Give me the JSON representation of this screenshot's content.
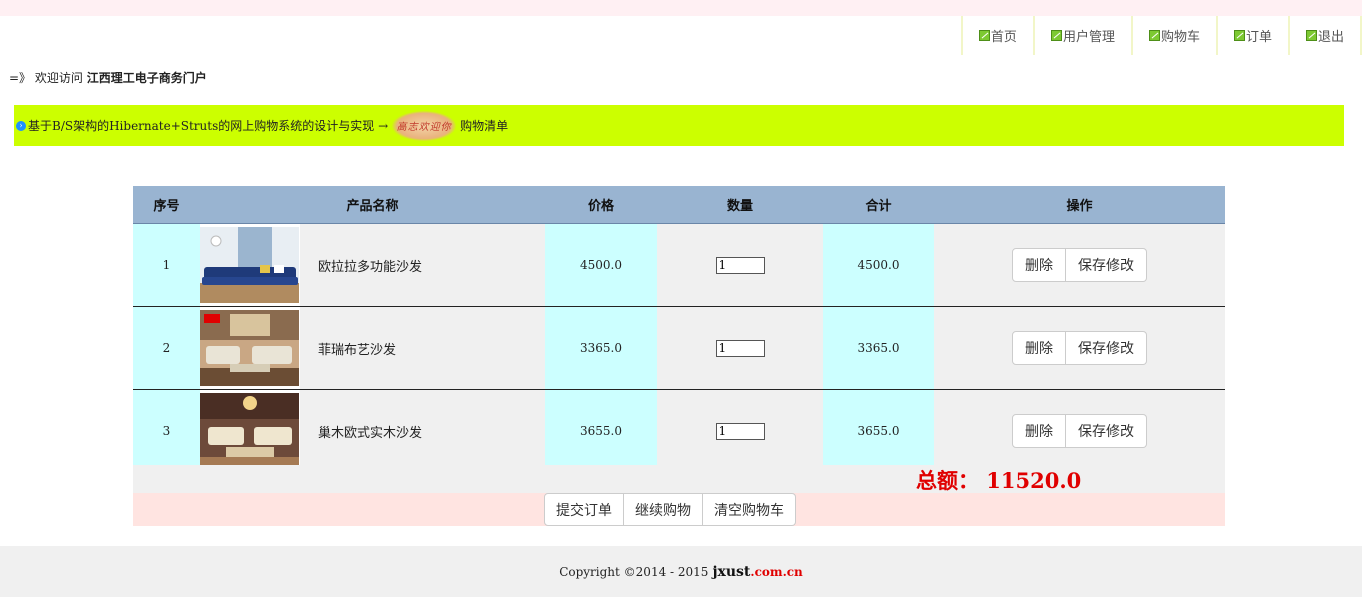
{
  "nav": {
    "items": [
      {
        "label": "首页"
      },
      {
        "label": "用户管理"
      },
      {
        "label": "购物车"
      },
      {
        "label": "订单"
      },
      {
        "label": "退出"
      }
    ]
  },
  "welcome": {
    "prefix": "=》 欢迎访问",
    "site_name": "江西理工电子商务门户"
  },
  "banner": {
    "breadcrumb": "基于B/S架构的Hibernate+Struts的网上购物系统的设计与实现 →",
    "welcome_image_text": "高志欢迎你",
    "page": "购物清单"
  },
  "table": {
    "headers": [
      "序号",
      "产品名称",
      "价格",
      "数量",
      "合计",
      "操作"
    ],
    "rows": [
      {
        "index": "1",
        "name": "欧拉拉多功能沙发",
        "price": "4500.0",
        "qty": "1",
        "subtotal": "4500.0"
      },
      {
        "index": "2",
        "name": "菲瑞布艺沙发",
        "price": "3365.0",
        "qty": "1",
        "subtotal": "3365.0"
      },
      {
        "index": "3",
        "name": "巢木欧式实木沙发",
        "price": "3655.0",
        "qty": "1",
        "subtotal": "3655.0"
      }
    ],
    "delete_label": "删除",
    "save_label": "保存修改"
  },
  "summary": {
    "total_text": "总额：  11520.0"
  },
  "actions": {
    "submit": "提交订单",
    "continue": "继续购物",
    "clear": "清空购物车"
  },
  "footer": {
    "copyright": "Copyright ©2014 - 2015",
    "brand_main": "jxust",
    "brand_suffix": ".com.cn"
  },
  "colors": {
    "banner_bg": "#ccff00",
    "header_bg": "#99b4d1",
    "accent_cyan": "#ccffff",
    "total_red": "#e00000"
  }
}
